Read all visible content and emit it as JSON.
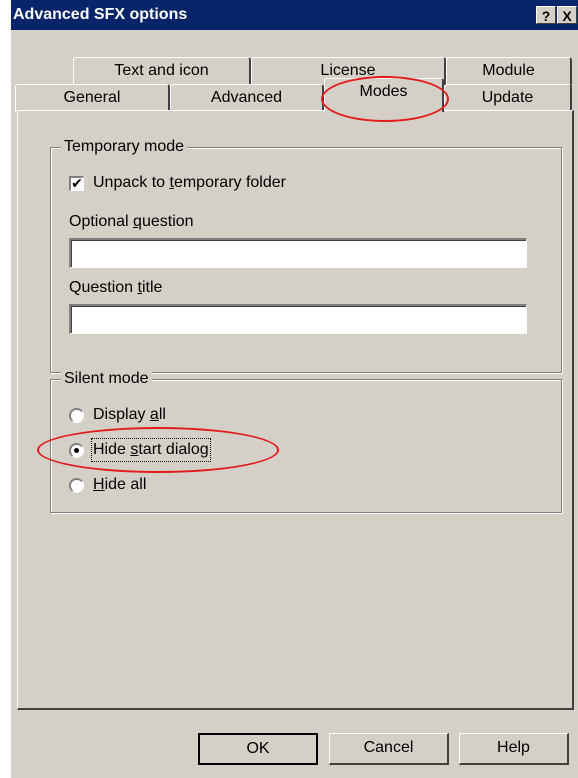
{
  "window": {
    "title": "Advanced SFX options",
    "help_button": "?",
    "close_button": "X"
  },
  "tabs": {
    "row_back": [
      "Text and icon",
      "License",
      "Module"
    ],
    "row_front": [
      "General",
      "Advanced",
      "Modes",
      "Update"
    ],
    "active": "Modes"
  },
  "temporary_mode": {
    "legend": "Temporary mode",
    "unpack_checkbox": {
      "pre": "Unpack to ",
      "accel": "t",
      "post": "emporary folder",
      "checked": true
    },
    "optional_question": {
      "pre": "Optional ",
      "accel": "q",
      "post": "uestion",
      "value": ""
    },
    "question_title": {
      "pre": "Question ",
      "accel": "t",
      "post": "itle",
      "value": ""
    }
  },
  "silent_mode": {
    "legend": "Silent mode",
    "options": [
      {
        "pre": "Display ",
        "accel": "a",
        "post": "ll",
        "selected": false
      },
      {
        "pre": "Hide ",
        "accel": "s",
        "post": "tart dialog",
        "selected": true
      },
      {
        "pre": "",
        "accel": "H",
        "post": "ide all",
        "selected": false
      }
    ]
  },
  "buttons": {
    "ok": "OK",
    "cancel": "Cancel",
    "help": "Help"
  },
  "annotation_color": "#e21b1b"
}
